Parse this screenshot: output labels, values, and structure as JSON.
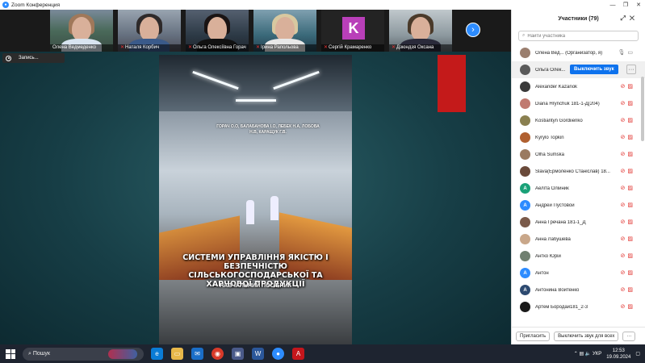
{
  "window": {
    "title": "Zoom Конференция"
  },
  "participants_strip": [
    {
      "name": "Олена Ведмеденко",
      "muted": false
    },
    {
      "name": "Наталя Корбич",
      "muted": true
    },
    {
      "name": "Ольга Олексіївна Горач",
      "muted": true
    },
    {
      "name": "Ірина Рапольова",
      "muted": true
    },
    {
      "name": "Сергій Крамаренко",
      "muted": true,
      "initial": "K"
    },
    {
      "name": "Дзюндзя Оксана",
      "muted": true
    }
  ],
  "recording": {
    "label": "Запись..."
  },
  "book": {
    "authors": "ГОРАЧ О.О, БАЛАБАНОВА І.О, ЛЕБЕК Н.А, ЛОБОВА Н.В, КАРАЩУК Г.В.",
    "title": "СИСТЕМИ УПРАВЛІННЯ ЯКІСТЮ І БЕЗПЕЧНІСТЮ СІЛЬСЬКОГОСПОДАРСЬКОЇ ТА ХАРЧОВОЇ ПРОДУКЦІЇ",
    "subtitle": "НАВЧАЛЬНИЙ ПОСІБНИК"
  },
  "panel": {
    "title": "Участники (79)",
    "search_placeholder": "Найти участника",
    "mute_button": "Выключить звук",
    "invite_button": "Пригласить",
    "mute_all_button": "Выключить звук для всех",
    "participants": [
      {
        "name": "Олена Вед... (Организатор, я)",
        "avatar_color": "#9a7e6e"
      },
      {
        "name": "Ольга Олек...",
        "avatar_color": "#5a5a5a"
      },
      {
        "name": "Alexander Kazanok",
        "avatar_color": "#3a3a3a"
      },
      {
        "name": "Diana Hrynchuk 181-1-Д(204)",
        "avatar_color": "#c07a70"
      },
      {
        "name": "Kostiantyn Gordiienko",
        "avatar_color": "#8a8050"
      },
      {
        "name": "Kyrylo Topkin",
        "avatar_color": "#b06030"
      },
      {
        "name": "Olha Sumska",
        "avatar_color": "#9a7a60"
      },
      {
        "name": "Slava(Ермоленко Станіслав) 18...",
        "avatar_color": "#6a4a3a"
      },
      {
        "name": "Аеліта Олійник",
        "avatar_color": "#1aa178",
        "initial": "А"
      },
      {
        "name": "Андрей Пустовой",
        "avatar_color": "#2d8cff",
        "initial": "А"
      },
      {
        "name": "Анна Гречана 181-1_Д",
        "avatar_color": "#7a5a4a"
      },
      {
        "name": "Анна Лабушева",
        "avatar_color": "#c9a78a"
      },
      {
        "name": "Антко Юрій",
        "avatar_color": "#708070"
      },
      {
        "name": "Антон",
        "avatar_color": "#2d8cff",
        "initial": "А"
      },
      {
        "name": "Антонина Войтенко",
        "avatar_color": "#2d4a70",
        "initial": "А"
      },
      {
        "name": "Артем Бородай181_2-3",
        "avatar_color": "#1a1a1a"
      }
    ]
  },
  "taskbar": {
    "search_label": "Пошук",
    "language": "УКР",
    "time": "12:53",
    "date": "19.09.2024"
  }
}
